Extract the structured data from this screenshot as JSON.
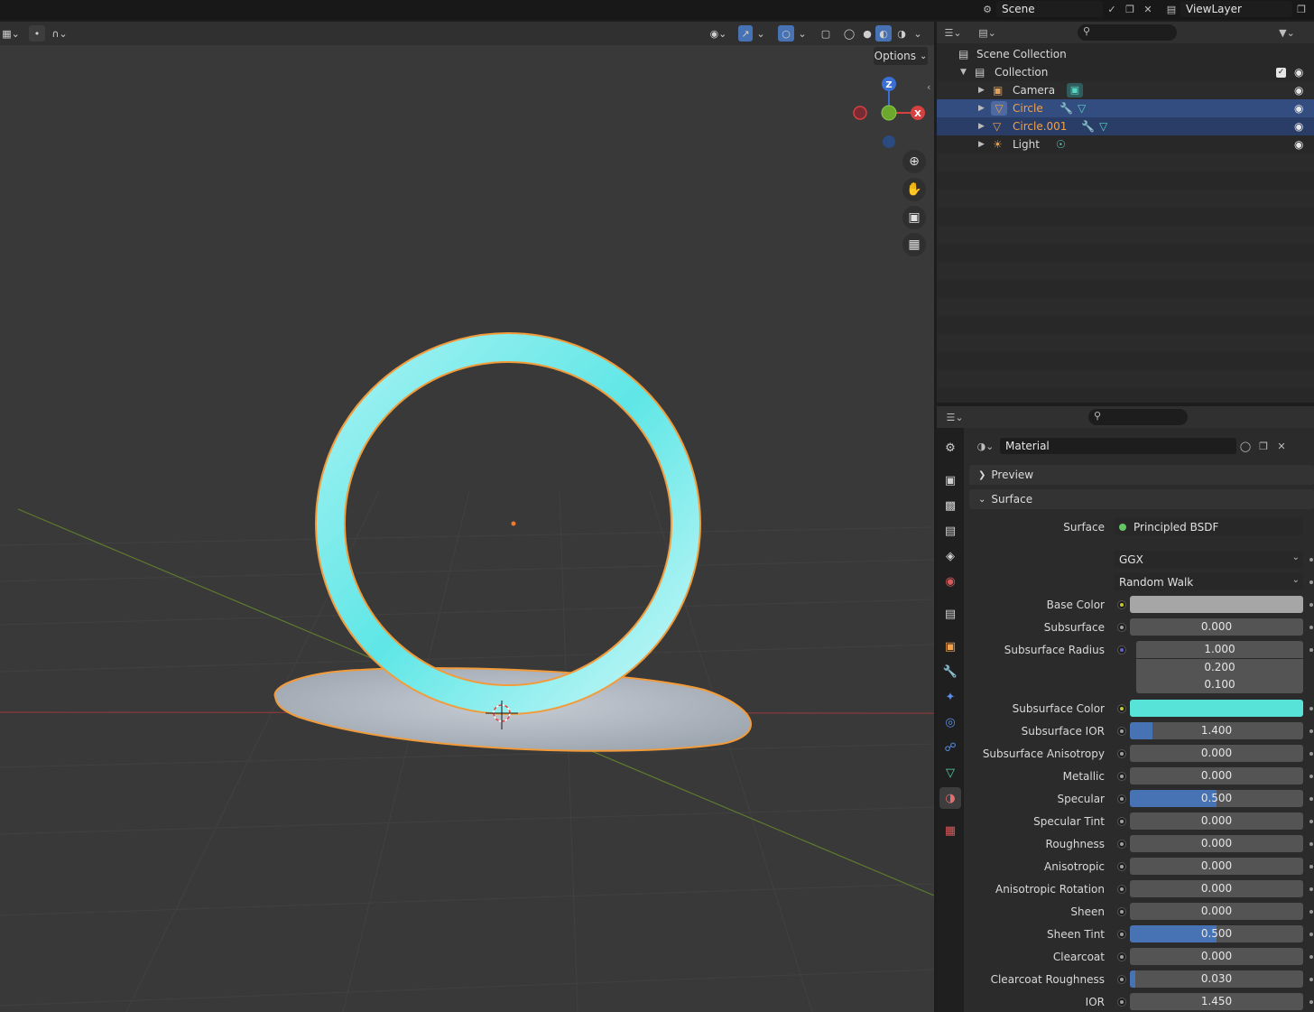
{
  "topbar": {
    "scene_label": "Scene",
    "viewlayer_label": "ViewLayer"
  },
  "viewport": {
    "options_label": "Options",
    "gizmo": {
      "z": "Z",
      "x": "X"
    }
  },
  "outliner": {
    "root": "Scene Collection",
    "items": [
      {
        "label": "Collection"
      },
      {
        "label": "Camera"
      },
      {
        "label": "Circle"
      },
      {
        "label": "Circle.001"
      },
      {
        "label": "Light"
      }
    ]
  },
  "properties": {
    "material_name": "Material",
    "preview_label": "Preview",
    "surface_section_label": "Surface",
    "surface_label": "Surface",
    "surface_shader": "Principled BSDF",
    "distribution": "GGX",
    "subsurface_method": "Random Walk",
    "rows": [
      {
        "label": "Base Color",
        "kind": "color",
        "color": "#a6a6a6",
        "socket": "yellow"
      },
      {
        "label": "Subsurface",
        "value": "0.000",
        "fill": 0
      },
      {
        "label": "Subsurface Radius",
        "kind": "vector",
        "values": [
          "1.000",
          "0.200",
          "0.100"
        ],
        "socket": "blue"
      },
      {
        "label": "Subsurface Color",
        "kind": "color",
        "color": "#57e3d8",
        "socket": "yellow"
      },
      {
        "label": "Subsurface IOR",
        "value": "1.400",
        "fill": 0.13
      },
      {
        "label": "Subsurface Anisotropy",
        "value": "0.000",
        "fill": 0
      },
      {
        "label": "Metallic",
        "value": "0.000",
        "fill": 0
      },
      {
        "label": "Specular",
        "value": "0.500",
        "fill": 0.5
      },
      {
        "label": "Specular Tint",
        "value": "0.000",
        "fill": 0
      },
      {
        "label": "Roughness",
        "value": "0.000",
        "fill": 0
      },
      {
        "label": "Anisotropic",
        "value": "0.000",
        "fill": 0
      },
      {
        "label": "Anisotropic Rotation",
        "value": "0.000",
        "fill": 0
      },
      {
        "label": "Sheen",
        "value": "0.000",
        "fill": 0
      },
      {
        "label": "Sheen Tint",
        "value": "0.500",
        "fill": 0.5
      },
      {
        "label": "Clearcoat",
        "value": "0.000",
        "fill": 0
      },
      {
        "label": "Clearcoat Roughness",
        "value": "0.030",
        "fill": 0.03
      },
      {
        "label": "IOR",
        "value": "1.450",
        "fill": 0
      }
    ]
  },
  "colors": {
    "accent": "#4772b3",
    "selection": "#334d80",
    "outline_orange": "#f2a04a",
    "ring_cyan": "#5fe6e6"
  }
}
